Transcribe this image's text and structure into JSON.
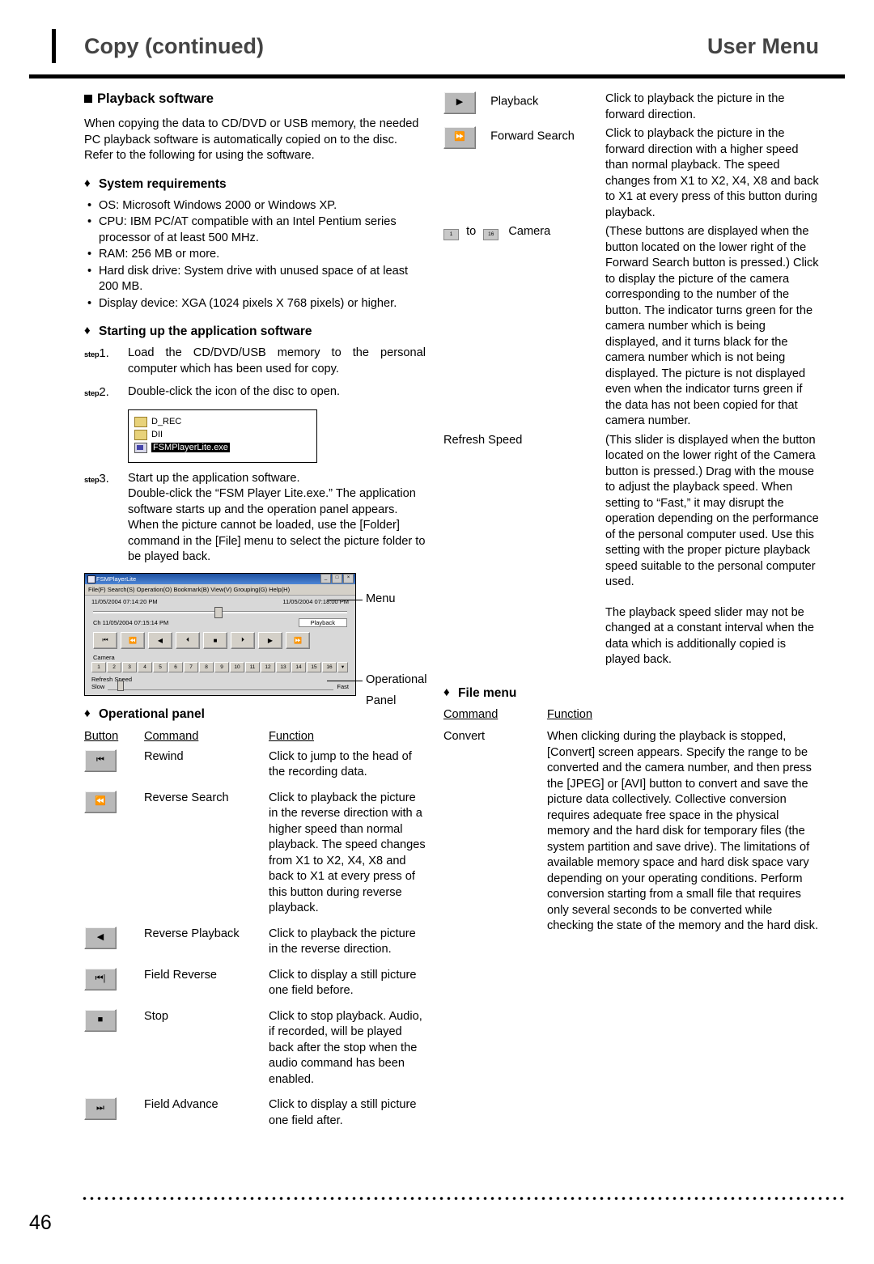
{
  "header": {
    "left_title": "Copy (continued)",
    "right_title": "User Menu"
  },
  "page_number": "46",
  "left": {
    "section_title": "Playback software",
    "intro": "When copying the data to CD/DVD or USB memory, the needed PC playback software is automatically copied on to the disc. Refer to the following for using the software.",
    "sysreq_title": "System requirements",
    "sysreq_items": [
      "OS: Microsoft Windows 2000 or Windows XP.",
      "CPU: IBM PC/AT compatible with an Intel Pentium series processor of at least 500 MHz.",
      "RAM: 256 MB or more.",
      "Hard disk drive: System drive with unused space of at least 200 MB.",
      "Display device: XGA (1024 pixels X 768 pixels) or higher."
    ],
    "startup_title": "Starting up the application software",
    "steps": [
      {
        "label": "step",
        "num": "1.",
        "text": "Load the CD/DVD/USB memory to the personal computer which has been used for copy."
      },
      {
        "label": "step",
        "num": "2.",
        "text": "Double-click the icon of the disc to open."
      },
      {
        "label": "step",
        "num": "3.",
        "text": "Start up the application software.\nDouble-click the “FSM Player Lite.exe.”  The application software starts up and the operation panel appears.\nWhen the picture cannot be loaded, use the [Folder] command in the [File] menu to select the picture folder to be played back."
      }
    ],
    "folder_box": {
      "items": [
        {
          "icon": "folder-icon",
          "name": "D_REC"
        },
        {
          "icon": "folder-icon",
          "name": "DII"
        },
        {
          "icon": "application-icon",
          "name": "FSMPlayerLite.exe"
        }
      ]
    },
    "player_window": {
      "title": "FSMPlayerLite",
      "window_buttons": [
        "_",
        "□",
        "×"
      ],
      "menubar": "File(F)  Search(S)  Operation(O)  Bookmark(B)  View(V)  Grouping(G)  Help(H)",
      "time_left": "11/05/2004 07:14:20 PM",
      "time_right": "11/05/2004 07:18:00 PM",
      "channel_label": "Ch 11/05/2004 07:15:14 PM",
      "playback_tag": "Playback",
      "transport_icons": [
        "⏮",
        "⏪",
        "◀",
        "⏴",
        "■",
        "⏵",
        "▶",
        "⏩"
      ],
      "camera_label": "Camera",
      "camera_numbers": [
        "1",
        "2",
        "3",
        "4",
        "5",
        "6",
        "7",
        "8",
        "9",
        "10",
        "11",
        "12",
        "13",
        "14",
        "15",
        "16"
      ],
      "refresh_label": "Refresh Speed",
      "refresh_slow": "Slow",
      "refresh_fast": "Fast"
    },
    "callouts": {
      "menu": "Menu",
      "operational": "Operational",
      "panel": "Panel"
    },
    "oppanel_title": "Operational panel",
    "table_headers": {
      "button": "Button",
      "command": "Command",
      "function": "Function"
    },
    "rows": [
      {
        "icon": "rewind-icon",
        "glyph": "⏮",
        "command": "Rewind",
        "function": "Click to jump to the head of the recording data."
      },
      {
        "icon": "reverse-search-icon",
        "glyph": "⏪",
        "command": "Reverse Search",
        "function": "Click to playback the picture in the reverse direction with a higher speed than normal playback. The speed changes from X1 to X2, X4, X8 and back to X1 at every press of this button during reverse playback."
      },
      {
        "icon": "reverse-playback-icon",
        "glyph": "◀",
        "command": "Reverse Playback",
        "function": "Click to playback the picture in the reverse direction."
      },
      {
        "icon": "field-reverse-icon",
        "glyph": "⏮|",
        "command": "Field Reverse",
        "function": "Click to display a still picture one field before."
      },
      {
        "icon": "stop-icon",
        "glyph": "■",
        "command": "Stop",
        "function": "Click to stop playback. Audio, if recorded, will be played back after the stop when the audio command has been enabled."
      },
      {
        "icon": "field-advance-icon",
        "glyph": "⏭",
        "command": "Field Advance",
        "function": "Click to display a still picture one field after."
      }
    ]
  },
  "right": {
    "rows": [
      {
        "icon": "playback-icon",
        "glyph": "▶",
        "command": "Playback",
        "function": "Click to playback the picture in the forward direction."
      },
      {
        "icon": "forward-search-icon",
        "glyph": "⏩",
        "command": "Forward Search",
        "function": "Click to playback the picture in the forward direction with a higher speed than normal playback. The speed changes from X1 to X2, X4, X8 and back to X1 at every press of this button during playback."
      },
      {
        "icon": "camera-number-buttons-icon",
        "command_prefix": "to",
        "command": "Camera",
        "btn_first": "1",
        "btn_last": "16",
        "function": "(These buttons are displayed when the  button located on the lower right of the Forward Search button is pressed.) Click to display the picture of the camera corresponding to the number of the button. The indicator turns green for the camera number which is being displayed, and it turns black for the camera number which is not being displayed. The picture is not displayed even when the indicator turns green if the data has not been copied for that camera number."
      },
      {
        "icon": "refresh-speed-slider",
        "command": "Refresh Speed",
        "function": "(This slider is displayed when the  button located on the lower right of the Camera button is pressed.) Drag with the mouse to adjust the playback speed. When setting to “Fast,” it may disrupt the operation depending on the performance of the personal computer used. Use this setting with the proper picture playback speed suitable to the personal computer used.",
        "function2": "The playback speed slider may not be changed at a constant interval when the data which is additionally copied is played back."
      }
    ],
    "filemenu_title": "File menu",
    "table_headers": {
      "command": "Command",
      "function": "Function"
    },
    "file_rows": [
      {
        "command": "Convert",
        "function": "When clicking during the playback is stopped, [Convert] screen appears. Specify the range to be converted and the camera number, and then press the [JPEG] or [AVI] button to convert and save the picture data collectively. Collective conversion requires adequate free space in the physical memory and the hard disk for temporary files (the system partition and save drive). The limitations of available memory space and hard disk space vary depending on your operating conditions. Perform conversion starting from a small file that requires only several seconds to be converted while checking the state of the memory and the hard disk."
      }
    ]
  }
}
